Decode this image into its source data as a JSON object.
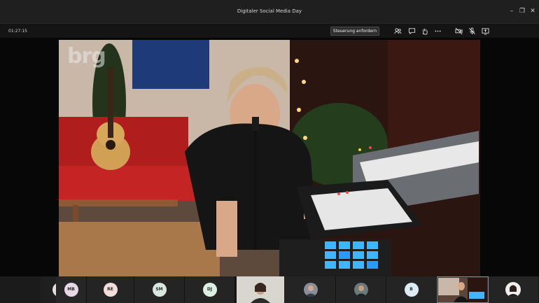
{
  "window": {
    "title": "Digitaler Social Media Day"
  },
  "toolbar": {
    "timer": "01:27:15",
    "request_control_label": "Steuerung anfordern"
  },
  "video": {
    "watermark": "brg"
  },
  "participants": [
    {
      "initials": "OI",
      "color": "#e6dede"
    },
    {
      "initials": "MB",
      "color": "#e6d8e6"
    },
    {
      "initials": "RE",
      "color": "#f2dcdc"
    },
    {
      "initials": "SM",
      "color": "#d8e8e0"
    },
    {
      "initials": "DJ",
      "color": "#dcefe4"
    },
    {
      "initials": "B",
      "color": "#dcecf2"
    }
  ],
  "colors": {
    "accent": "#6264a7"
  }
}
